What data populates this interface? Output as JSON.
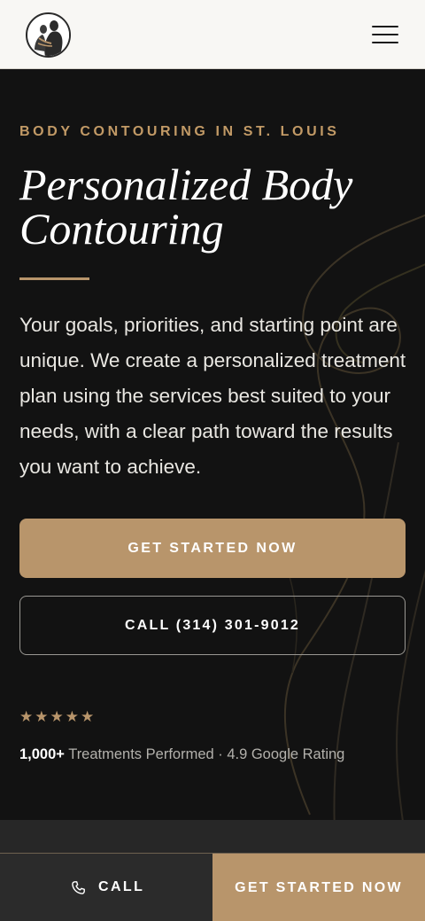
{
  "header": {
    "logo_icon": "silhouette-logo-icon",
    "menu_icon": "hamburger-menu-icon"
  },
  "hero": {
    "eyebrow": "BODY CONTOURING IN ST. LOUIS",
    "title_line1": "Personalized Body",
    "title_line2": "Contouring",
    "description": "Your goals, priorities, and starting point are unique. We create a personalized treatment plan using the services best suited to your needs, with a clear path toward the results you want to achieve.",
    "primary_cta": "GET STARTED NOW",
    "call_cta": "CALL (314) 301-9012",
    "stars": "★★★★★",
    "rating_value": 5,
    "stats_count": "1,000+",
    "stats_text": " Treatments Performed · 4.9 Google Rating"
  },
  "sticky_bar": {
    "call_label": "CALL",
    "call_icon": "phone-icon",
    "cta_label": "GET STARTED NOW"
  },
  "colors": {
    "accent": "#b8956b",
    "eyebrow": "#c29a66",
    "hero_bg": "#121212",
    "header_bg": "#f8f7f4"
  }
}
